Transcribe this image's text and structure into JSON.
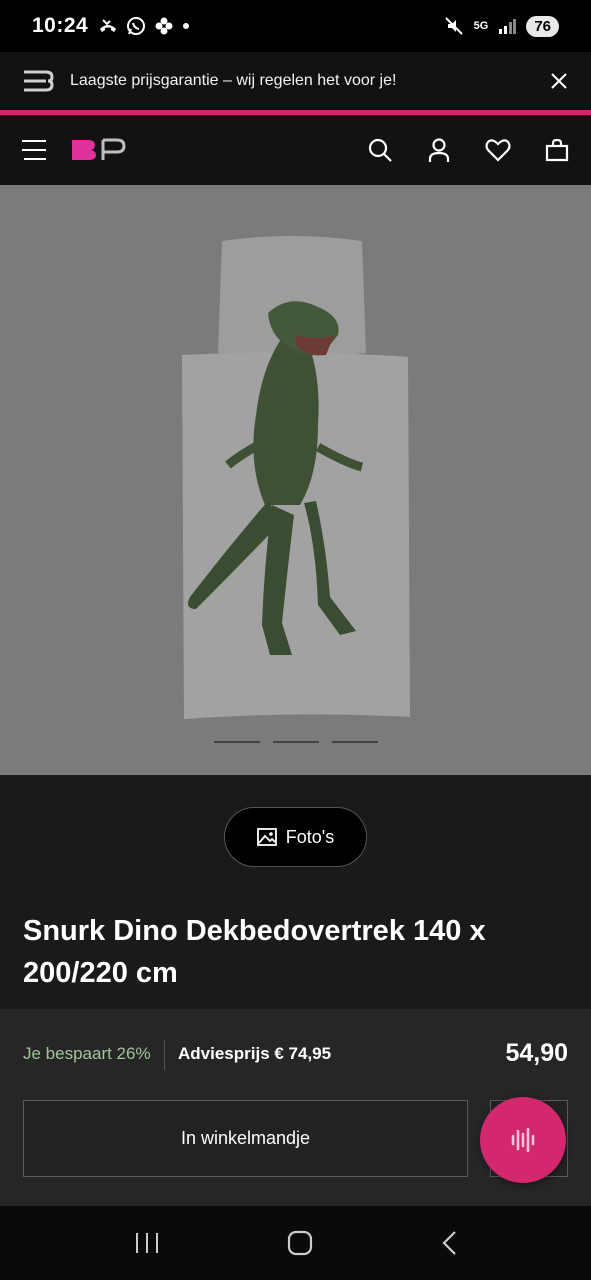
{
  "status_bar": {
    "time": "10:24",
    "network": "5G",
    "battery": "76",
    "icons": [
      "missed-call-icon",
      "whatsapp-icon",
      "flower-icon",
      "dot-icon",
      "mute-icon",
      "signal-icon"
    ]
  },
  "promo": {
    "text": "Laagste prijsgarantie – wij regelen het voor je!",
    "accent_color": "#d6246e"
  },
  "header": {
    "brand_letters": "BP",
    "brand_color": "#e0309a",
    "icons": [
      "menu-icon",
      "search-icon",
      "account-icon",
      "heart-icon",
      "bag-icon"
    ]
  },
  "gallery": {
    "slides": 3,
    "photos_button_label": "Foto's"
  },
  "product": {
    "title": "Snurk Dino Dekbedovertrek 140 x 200/220 cm",
    "savings": "Je bespaart 26%",
    "advice_price": "Adviesprijs € 74,95",
    "price": "54,90",
    "cart_button_label": "In winkelmandje"
  },
  "colors": {
    "savings_green": "#a3c49b",
    "fab_pink": "#d3286e"
  }
}
